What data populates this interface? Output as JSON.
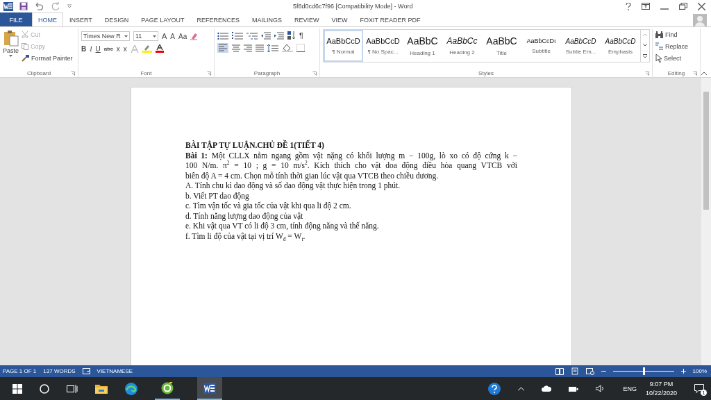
{
  "window": {
    "title": "5f8d0cd6c7f96 [Compatibility Mode] - Word"
  },
  "tabs": [
    {
      "label": "FILE",
      "kind": "file",
      "selected": false
    },
    {
      "label": "HOME",
      "kind": "tab",
      "selected": true
    },
    {
      "label": "INSERT",
      "kind": "tab",
      "selected": false
    },
    {
      "label": "DESIGN",
      "kind": "tab",
      "selected": false
    },
    {
      "label": "PAGE LAYOUT",
      "kind": "tab",
      "selected": false
    },
    {
      "label": "REFERENCES",
      "kind": "tab",
      "selected": false
    },
    {
      "label": "MAILINGS",
      "kind": "tab",
      "selected": false
    },
    {
      "label": "REVIEW",
      "kind": "tab",
      "selected": false
    },
    {
      "label": "VIEW",
      "kind": "tab",
      "selected": false
    },
    {
      "label": "FOXIT READER PDF",
      "kind": "tab",
      "selected": false
    }
  ],
  "clipboard": {
    "label": "Clipboard",
    "paste": "Paste",
    "cut": "Cut",
    "copy": "Copy",
    "format_painter": "Format Painter"
  },
  "font": {
    "label": "Font",
    "name": "Times New R",
    "size": "11",
    "grow": "A",
    "shrink": "A",
    "case": "Aa",
    "bold": "B",
    "italic": "I",
    "underline": "U",
    "strike": "abc",
    "sub": "x",
    "sup": "x"
  },
  "paragraph": {
    "label": "Paragraph",
    "pilcrow": "¶"
  },
  "styles": {
    "label": "Styles",
    "items": [
      {
        "preview": "AaBbCcD",
        "name": "¶ Normal",
        "kind": "normal",
        "selected": true
      },
      {
        "preview": "AaBbCcD",
        "name": "¶ No Spac...",
        "kind": "normal",
        "selected": false
      },
      {
        "preview": "AaBbC",
        "name": "Heading 1",
        "kind": "large",
        "selected": false
      },
      {
        "preview": "AaBbCc",
        "name": "Heading 2",
        "kind": "italic",
        "selected": false
      },
      {
        "preview": "AaBbC",
        "name": "Title",
        "kind": "large",
        "selected": false
      },
      {
        "preview": "AaBbCcDı",
        "name": "Subtitle",
        "kind": "small",
        "selected": false
      },
      {
        "preview": "AaBbCcD",
        "name": "Subtle Em...",
        "kind": "italic-small",
        "selected": false
      },
      {
        "preview": "AaBbCcD",
        "name": "Emphasis",
        "kind": "italic-small",
        "selected": false
      }
    ]
  },
  "editing": {
    "label": "Editing",
    "find": "Find",
    "replace": "Replace",
    "select": "Select"
  },
  "document": {
    "lines": [
      {
        "kind": "heading",
        "text": "BÀI TẬP TỰ LUẬN.CHỦ ĐỀ 1(TIẾT 4)"
      },
      {
        "kind": "justify",
        "text": "**Bài 1:** Một CLLX nằm ngang gồm vật nặng có khối lượng m − 100g, lò xo có độ cứng k −"
      },
      {
        "kind": "justify",
        "text": "100 N/m. π$^{2}$ = 10 ; g = 10 m/s$^{2}$. Kích thích cho vật doa động điều hòa quang VTCB với"
      },
      {
        "kind": "plain",
        "text": "biên độ A = 4 cm. Chọn mỗ tính thời gian lúc vật qua VTCB theo chiều dương."
      },
      {
        "kind": "plain",
        "text": "A. Tính chu kì dao động và số dao động vật thực hiện trong 1 phút."
      },
      {
        "kind": "plain",
        "text": "b. Viết PT dao động"
      },
      {
        "kind": "plain",
        "text": "c. Tìm vận tốc và gia tốc của vật khi qua li độ 2 cm."
      },
      {
        "kind": "plain",
        "text": "d. Tính năng lượng dao động của vật"
      },
      {
        "kind": "plain",
        "text": "e. Khi vật qua VT có li độ 3 cm, tính động năng và thế năng."
      },
      {
        "kind": "plain",
        "text": "f. Tìm li độ của vật tại vị trí W$_{đ}$ = W$_{t}$."
      }
    ]
  },
  "status_bar": {
    "page": "PAGE 1 OF 1",
    "words": "137 WORDS",
    "language": "VIETNAMESE",
    "zoom": {
      "level": 0.5
    },
    "zoom_text": "100%"
  },
  "taskbar": {
    "language": "ENG",
    "time": "9:07 PM",
    "date": "10/22/2020",
    "notifications": "1"
  }
}
